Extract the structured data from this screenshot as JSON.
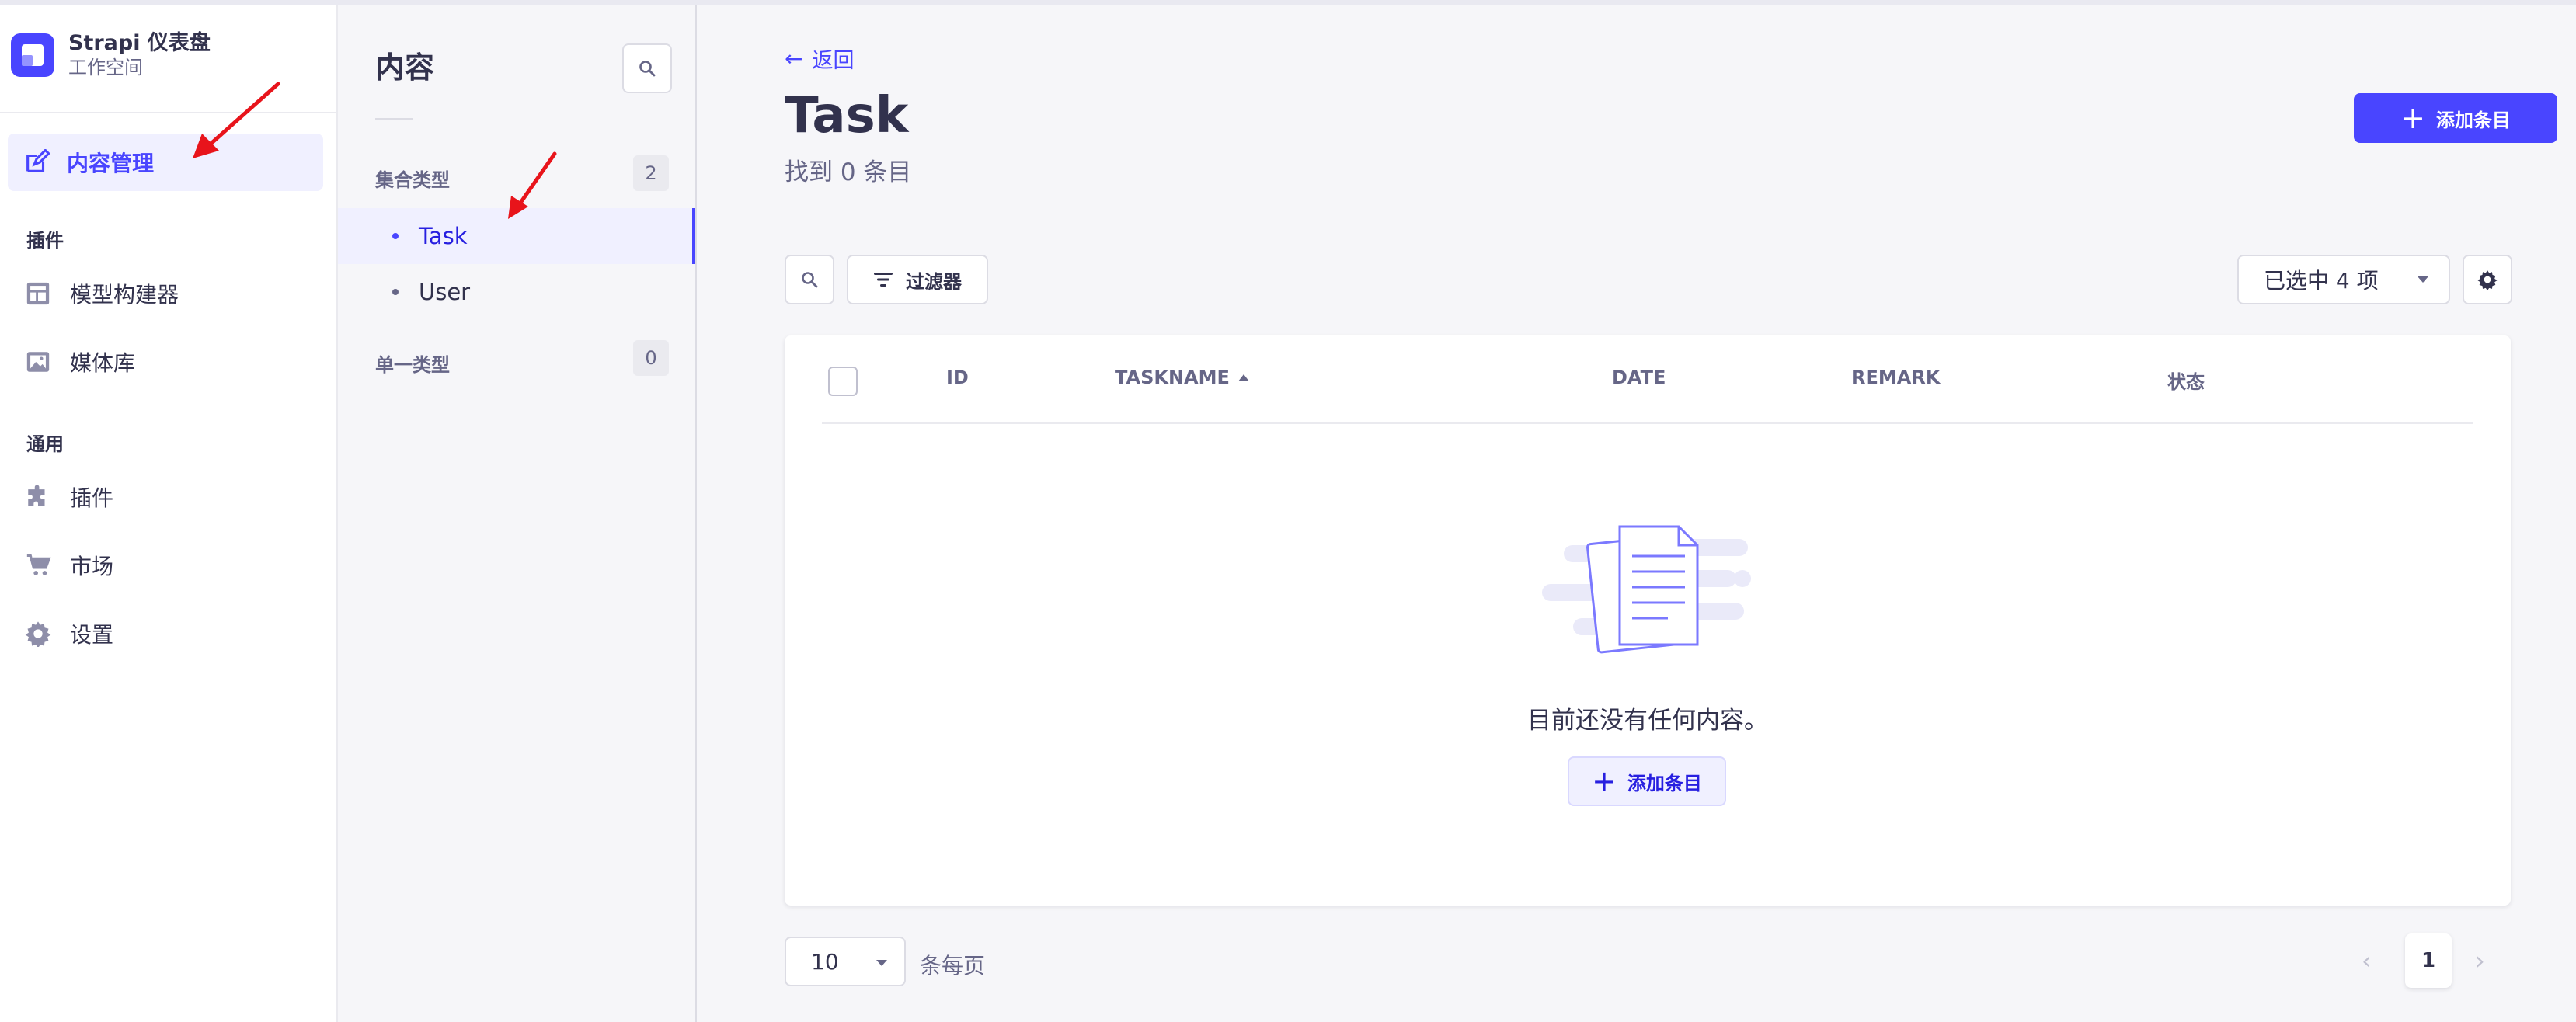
{
  "app": {
    "brand_title": "Strapi 仪表盘",
    "brand_subtitle": "工作空间"
  },
  "leftnav": {
    "active_item": "内容管理",
    "section_plugins": "插件",
    "plugins": [
      {
        "label": "模型构建器",
        "icon": "layout-icon"
      },
      {
        "label": "媒体库",
        "icon": "image-icon"
      }
    ],
    "section_general": "通用",
    "general": [
      {
        "label": "插件",
        "icon": "puzzle-icon"
      },
      {
        "label": "市场",
        "icon": "cart-icon"
      },
      {
        "label": "设置",
        "icon": "gear-icon"
      }
    ]
  },
  "subnav": {
    "title": "内容",
    "collection_types_label": "集合类型",
    "collection_types_count": "2",
    "collection_types": [
      "Task",
      "User"
    ],
    "single_types_label": "单一类型",
    "single_types_count": "0"
  },
  "main": {
    "back_label": "返回",
    "title": "Task",
    "subtitle": "找到 0 条目",
    "add_entry_label": "添加条目",
    "filter_label": "过滤器",
    "columns_selected": "已选中 4 项",
    "columns": [
      "ID",
      "TASKNAME",
      "DATE",
      "REMARK",
      "状态"
    ],
    "empty_text": "目前还没有任何内容。",
    "empty_add_label": "添加条目",
    "page_size": "10",
    "page_size_label": "条每页",
    "current_page": "1"
  },
  "colors": {
    "primary": "#4945ff",
    "primary_light": "#f0f0ff",
    "annotation_red": "#e8141b"
  }
}
